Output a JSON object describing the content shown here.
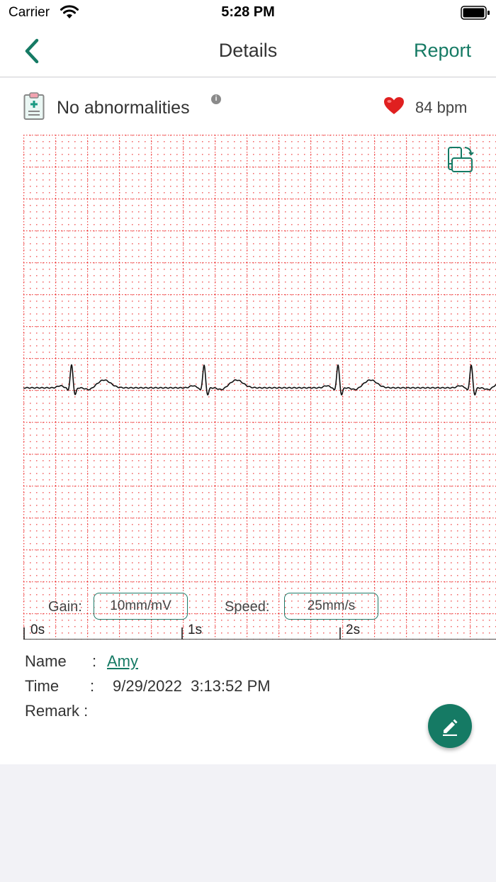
{
  "status_bar": {
    "carrier": "Carrier",
    "time": "5:28 PM"
  },
  "nav": {
    "title": "Details",
    "report_label": "Report"
  },
  "result": {
    "text": "No abnormalities",
    "info_glyph": "i",
    "heart_rate": "84 bpm"
  },
  "ecg": {
    "gain_label": "Gain:",
    "gain_value": "10mm/mV",
    "speed_label": "Speed:",
    "speed_value": "25mm/s",
    "time_ticks": [
      "0s",
      "1s",
      "2s"
    ],
    "grid_color": "#ef4444",
    "trace_color": "#111111"
  },
  "record": {
    "name_label": "Name",
    "name_value": "Amy",
    "time_label": "Time",
    "time_value": "9/29/2022  3:13:52 PM",
    "remark_label": "Remark :",
    "colon": ":"
  },
  "icons": {
    "back": "chevron-left-icon",
    "clipboard": "clipboard-medical-icon",
    "info": "info-icon",
    "heart": "heart-icon",
    "rotate": "rotate-screen-icon",
    "edit": "pencil-icon"
  },
  "colors": {
    "accent": "#157a64",
    "heart": "#e02020"
  }
}
